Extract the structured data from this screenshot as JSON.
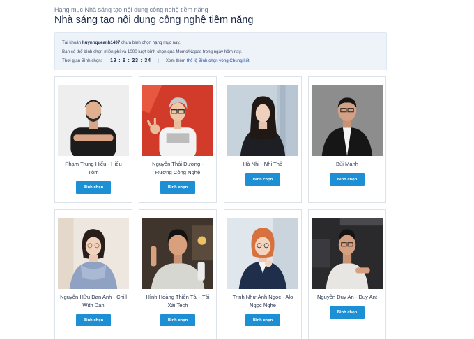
{
  "breadcrumb": "Hạng mục Nhà sáng tạo nội dung công nghệ tiềm năng",
  "title": "Nhà sáng tạo nội dung công nghệ tiềm năng",
  "info": {
    "line1_prefix": "Tài khoản",
    "username": "huynhqueanh1407",
    "line1_suffix": "chưa bình chọn hạng mục này.",
    "line2": "Bạn có thể bình chọn miễn phí và 1000 lượt bình chọn qua Momo/Napas trong ngày hôm nay.",
    "time_label": "Thời gian Bình chọn:",
    "countdown": "19 : 9 : 23 : 34",
    "separator": "|",
    "rules_prefix": "Xem thêm",
    "rules_link": "thể lệ Bình chọn vòng Chung kết"
  },
  "vote_label": "Bình chọn",
  "nominees": [
    {
      "name": "Phạm Trung Hiếu - Hiếu Tôm"
    },
    {
      "name": "Nguyễn Thái Dương - Rương Công Nghệ"
    },
    {
      "name": "Hà Nhi - Nhi Thỏ"
    },
    {
      "name": "Bùi Mạnh"
    },
    {
      "name": "Nguyễn Hữu Đan Anh - Chill With Dan"
    },
    {
      "name": "Hình Hoàng Thiên Tài - Tài Xài Tech"
    },
    {
      "name": "Trịnh Như Ánh Ngọc - Alo Ngọc Nghe"
    },
    {
      "name": "Nguyễn Duy An - Duy Ant"
    }
  ]
}
